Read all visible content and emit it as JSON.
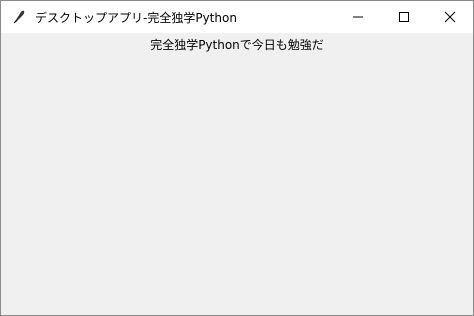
{
  "window": {
    "title": "デスクトップアプリ-完全独学Python",
    "app_icon": "feather-icon",
    "controls": {
      "minimize": "minimize-icon",
      "maximize": "maximize-icon",
      "close": "close-icon"
    }
  },
  "content": {
    "label_text": "完全独学Pythonで今日も勉強だ"
  },
  "colors": {
    "titlebar_bg": "#ffffff",
    "content_bg": "#f0f0f0",
    "text": "#000000"
  }
}
